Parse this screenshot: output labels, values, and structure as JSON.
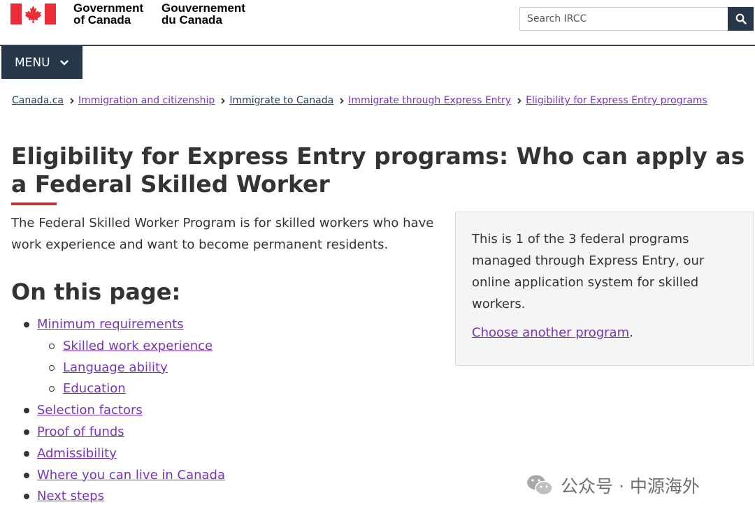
{
  "header": {
    "signature_en_line1": "Government",
    "signature_en_line2": "of Canada",
    "signature_fr_line1": "Gouvernement",
    "signature_fr_line2": "du Canada",
    "search_placeholder": "Search IRCC",
    "flag_color": "#eb2d37",
    "accent_color": "#26374a"
  },
  "menu": {
    "label": "MENU"
  },
  "breadcrumb": [
    {
      "label": "Canada.ca"
    },
    {
      "label": "Immigration and citizenship"
    },
    {
      "label": "Immigrate to Canada"
    },
    {
      "label": "Immigrate through Express Entry"
    },
    {
      "label": "Eligibility for Express Entry programs"
    }
  ],
  "main": {
    "title": "Eligibility for Express Entry programs: Who can apply as a Federal Skilled Worker",
    "intro": "The Federal Skilled Worker Program is for skilled workers who have work experience and want to become permanent residents.",
    "toc_heading": "On this page:",
    "toc": [
      {
        "label": "Minimum requirements"
      },
      {
        "label": "Skilled work experience"
      },
      {
        "label": "Language ability"
      },
      {
        "label": "Education"
      },
      {
        "label": "Selection factors"
      },
      {
        "label": "Proof of funds"
      },
      {
        "label": "Admissibility"
      },
      {
        "label": "Where you can live in Canada"
      },
      {
        "label": "Next steps"
      }
    ]
  },
  "panel": {
    "text": "This is 1 of the 3 federal programs managed through Express Entry, our online application system for skilled workers.",
    "link_label": "Choose another program",
    "link_suffix": "."
  },
  "watermark": {
    "text": "公众号 · 中源海外"
  },
  "colors": {
    "link_visited": "#7834bc",
    "link_default": "#284162",
    "title_rule": "#af3c43"
  }
}
